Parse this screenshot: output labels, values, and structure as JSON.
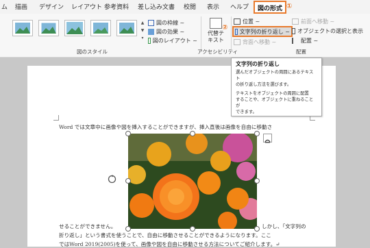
{
  "tabs": [
    {
      "label": "ム"
    },
    {
      "label": "描画"
    },
    {
      "label": "デザイン"
    },
    {
      "label": "レイアウト"
    },
    {
      "label": "参考資料"
    },
    {
      "label": "差し込み文書"
    },
    {
      "label": "校閲"
    },
    {
      "label": "表示"
    },
    {
      "label": "ヘルプ"
    },
    {
      "label": "図の形式"
    }
  ],
  "callouts": {
    "one": "①",
    "two": "②"
  },
  "ribbon": {
    "style_commands": [
      "図の枠線 ~",
      "図の効果 ~",
      "図のレイアウト ~"
    ],
    "group_picture_styles": "図のスタイル",
    "alt_text_line1": "代替テ",
    "alt_text_line2": "キスト",
    "group_accessibility": "アクセシビリティ",
    "position": "位置 ~",
    "wrap_text": "文字列の折り返し ~",
    "bring_forward": "前面へ移動 ~",
    "send_backward": "背面へ移動 ~",
    "selection_pane": "オブジェクトの選択と表示",
    "align": "配置 ~",
    "group_arrange": "配置"
  },
  "tooltip": {
    "title": "文字列の折り返し",
    "desc1": "選んだオブジェクトの周囲にあるテキスト",
    "desc2": "の折り返し方法を選びます。",
    "desc3": "テキストをオブジェクトの周囲に配置",
    "desc4": "することや、オブジェクトに重ねることが",
    "desc5": "できます。"
  },
  "document": {
    "line1": "Word では文章中に画像や図を挿入することができますが、挿入直後は画像を自由に移動さ",
    "line2a": "せることができません。",
    "line2b": "しかし、「文字列の",
    "line3a": "折り返し」という書式を使うことで、自由に移動させることができるようになります。ここ",
    "line4a": "ではWord 2019(2005)を使って、画像や図を自由に移動させる方法についてご紹介します。↵"
  },
  "colors": {
    "accent": "#e8792b",
    "ribbon_bg": "#f7f7f7",
    "doc_bg": "#c8c8c8"
  }
}
